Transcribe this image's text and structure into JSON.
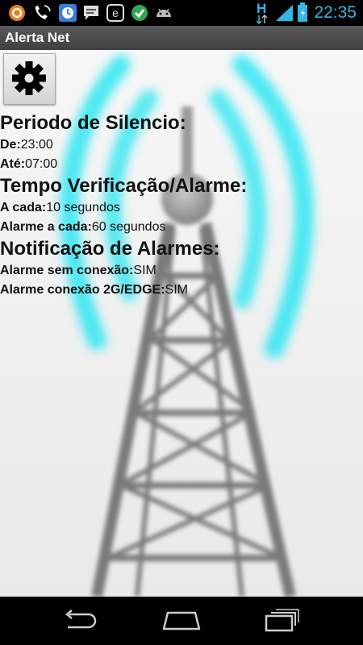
{
  "status_bar": {
    "time": "22:35",
    "network_type": "H",
    "notification_icons": [
      "avast-icon",
      "phone-icon",
      "clock-icon",
      "message-icon",
      "e-icon",
      "check-icon",
      "android-icon"
    ]
  },
  "app": {
    "title": "Alerta Net"
  },
  "settings_button": {
    "icon": "gear-icon"
  },
  "sections": {
    "silence": {
      "title": "Periodo de Silencio:",
      "from_label": "De:",
      "from_value": "23:00",
      "to_label": "Até:",
      "to_value": "07:00"
    },
    "verify": {
      "title": "Tempo Verificação/Alarme:",
      "every_label": "A cada:",
      "every_value": "10 segundos",
      "alarm_label": "Alarme a cada:",
      "alarm_value": "60 segundos"
    },
    "notify": {
      "title": "Notificação de Alarmes:",
      "no_conn_label": "Alarme sem conexão:",
      "no_conn_value": "SIM",
      "edge_label": "Alarme conexão 2G/EDGE:",
      "edge_value": "SIM"
    }
  },
  "nav_bar": {
    "buttons": [
      "back-icon",
      "home-icon",
      "recents-icon"
    ]
  },
  "colors": {
    "accent": "#33b5e5",
    "signal_waves": "#22e6f2"
  }
}
